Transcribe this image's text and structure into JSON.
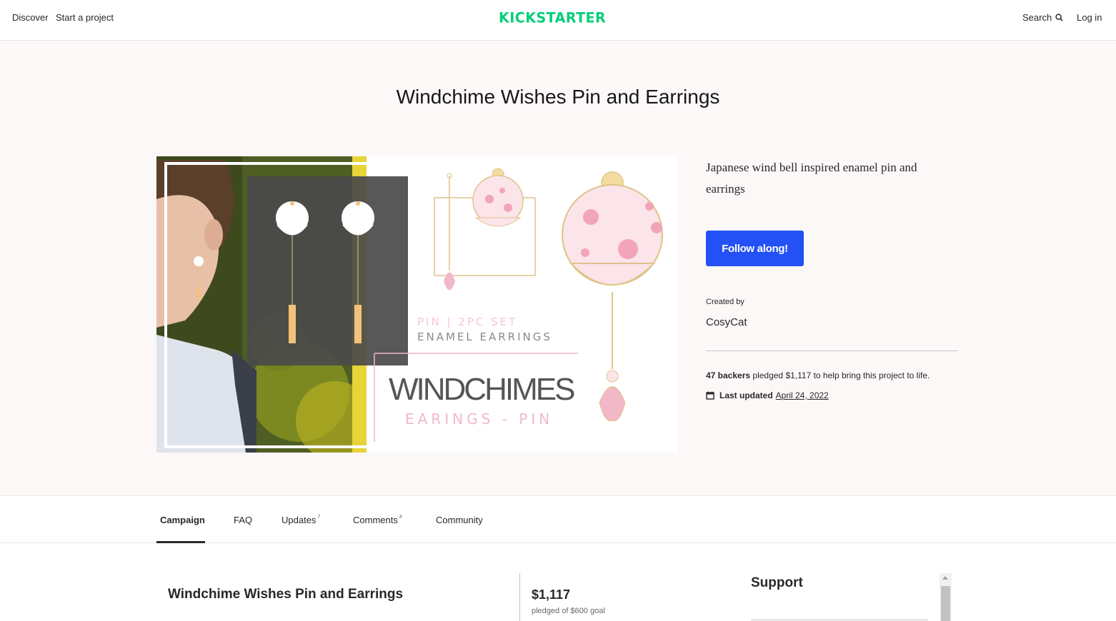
{
  "nav": {
    "discover": "Discover",
    "start_project": "Start a project",
    "logo": "KICKSTARTER",
    "search": "Search",
    "login": "Log in"
  },
  "project": {
    "title": "Windchime Wishes Pin and Earrings",
    "blurb": "Japanese wind bell inspired enamel pin and earrings",
    "follow_label": "Follow along!",
    "created_by_label": "Created by",
    "creator": "CosyCat",
    "backers_count": "47 backers",
    "pledged_sentence": " pledged $1,117 to help bring this project to life.",
    "last_updated_label": "Last updated",
    "last_updated_date": "April 24, 2022"
  },
  "image_text": {
    "pin_set": "PIN | 2PC SET",
    "enamel": "ENAMEL EARRINGS",
    "windchimes": "WINDCHIMES",
    "earings_pin": "EARINGS - PIN"
  },
  "tabs": [
    {
      "label": "Campaign",
      "count": ""
    },
    {
      "label": "FAQ",
      "count": ""
    },
    {
      "label": "Updates",
      "count": "7"
    },
    {
      "label": "Comments",
      "count": "4"
    },
    {
      "label": "Community",
      "count": ""
    }
  ],
  "story": {
    "title": "Windchime Wishes Pin and Earrings"
  },
  "funding": {
    "pledged": "$1,117",
    "goal_text": "pledged of $600 goal"
  },
  "support": {
    "heading": "Support"
  },
  "colors": {
    "brand_green": "#05ce78",
    "button_blue": "#2451f5",
    "hero_bg": "#fcf8f7",
    "pink_accent": "#f2b8c8",
    "gold_accent": "#e0c388"
  },
  "icons": {
    "search": "search-icon",
    "calendar": "calendar-icon"
  }
}
